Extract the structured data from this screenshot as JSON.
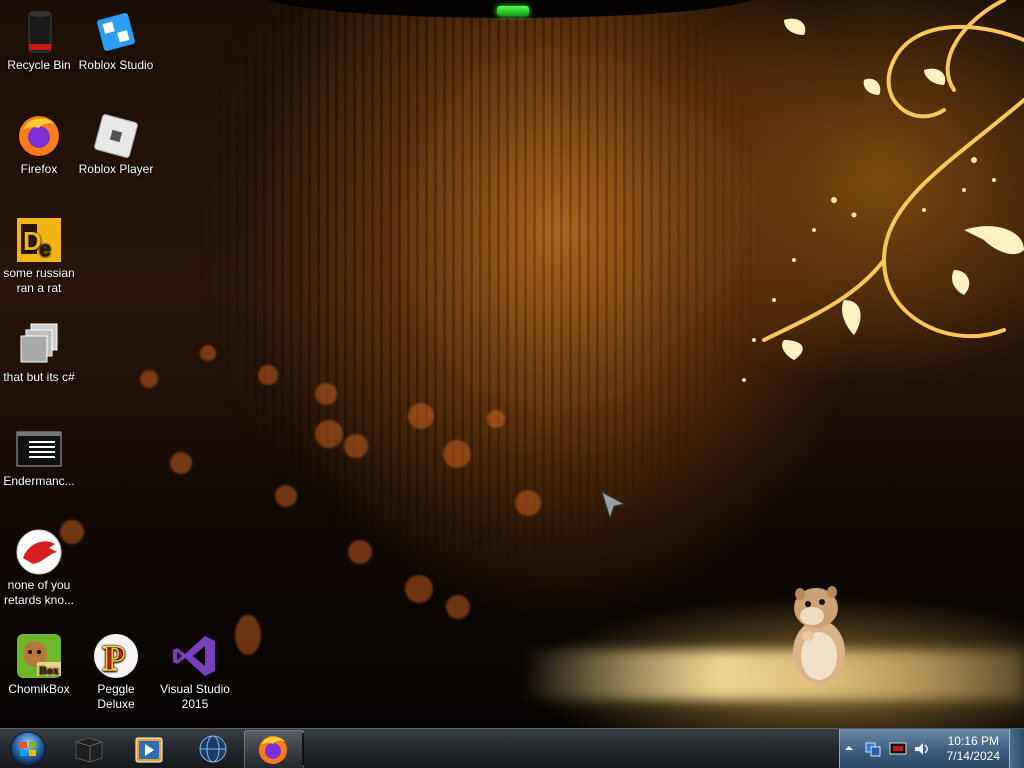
{
  "desktop": {
    "icons": [
      {
        "label": "Recycle Bin",
        "icon": "recycle-bin-icon"
      },
      {
        "label": "Roblox Studio",
        "icon": "roblox-studio-icon"
      },
      {
        "label": "Firefox",
        "icon": "firefox-icon"
      },
      {
        "label": "Roblox Player",
        "icon": "roblox-player-icon"
      },
      {
        "label": "some russian ran a rat",
        "icon": "de-app-icon"
      },
      {
        "label": "that but its c#",
        "icon": "windows-stack-icon"
      },
      {
        "label": "Endermanc...",
        "icon": "terminal-window-icon"
      },
      {
        "label": "none of you retards kno...",
        "icon": "red-dragon-icon"
      },
      {
        "label": "ChomikBox",
        "icon": "chomikbox-icon"
      },
      {
        "label": "Peggle Deluxe",
        "icon": "peggle-icon"
      },
      {
        "label": "Visual Studio 2015",
        "icon": "visual-studio-icon"
      }
    ]
  },
  "taskbar": {
    "start": {
      "icon": "windows-orb-icon"
    },
    "pinned": [
      {
        "icon": "black-box-icon"
      },
      {
        "icon": "media-player-icon"
      },
      {
        "icon": "globe-icon"
      },
      {
        "icon": "firefox-icon",
        "active": true
      }
    ],
    "tray": {
      "icons": [
        "show-hidden-icons-arrow",
        "network-icon",
        "red-monitor-icon",
        "speaker-icon"
      ],
      "time": "10:16 PM",
      "date": "7/14/2024"
    }
  },
  "colors": {
    "taskbar": "#23272b",
    "tray": "#3a5a78",
    "accent_gold": "#f5c24a",
    "green_bar": "#33ff33"
  }
}
